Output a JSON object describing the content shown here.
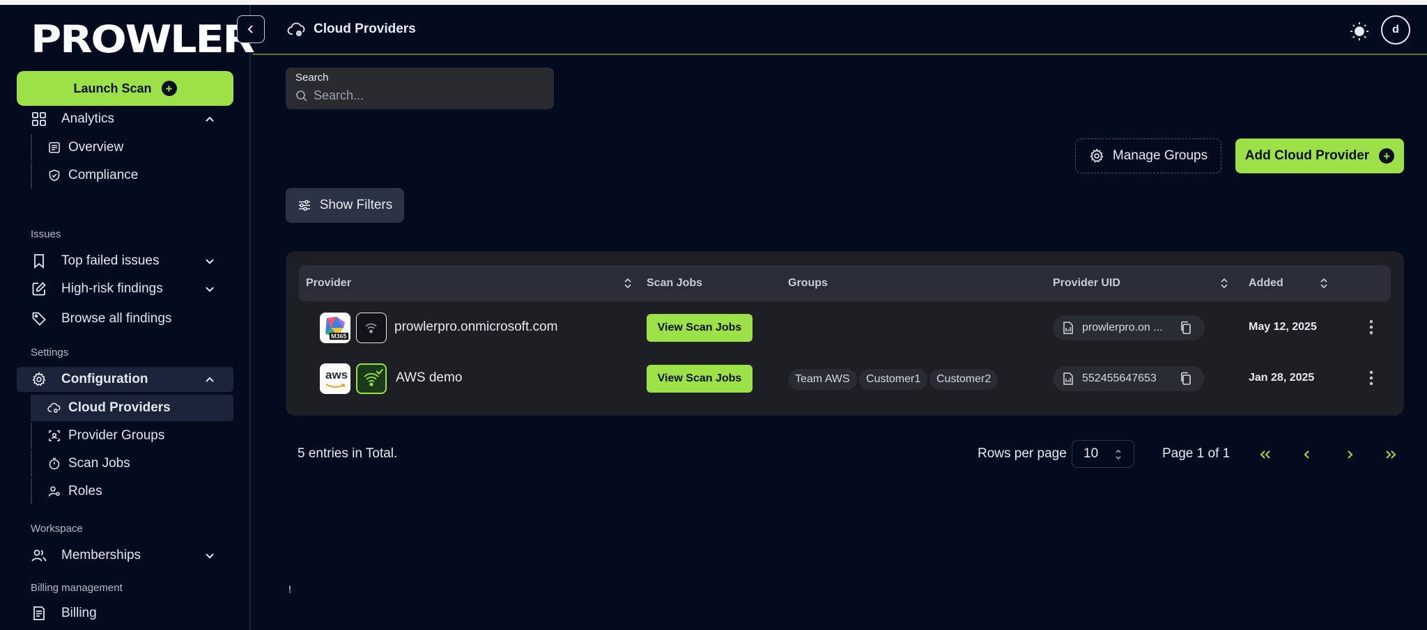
{
  "app": {
    "logo_text": "PROWLER"
  },
  "sidebar": {
    "launch_scan": "Launch Scan",
    "analytics": "Analytics",
    "overview": "Overview",
    "compliance": "Compliance",
    "issues_section": "Issues",
    "top_failed": "Top failed issues",
    "high_risk": "High-risk findings",
    "browse_all": "Browse all findings",
    "settings_section": "Settings",
    "configuration": "Configuration",
    "cloud_providers": "Cloud Providers",
    "provider_groups": "Provider Groups",
    "scan_jobs": "Scan Jobs",
    "roles": "Roles",
    "workspace_section": "Workspace",
    "memberships": "Memberships",
    "billing_section": "Billing management",
    "billing": "Billing"
  },
  "header": {
    "title": "Cloud Providers",
    "avatar_initial": "d"
  },
  "search": {
    "label": "Search",
    "placeholder": "Search..."
  },
  "actions": {
    "manage_groups": "Manage Groups",
    "add_provider": "Add Cloud Provider",
    "show_filters": "Show Filters"
  },
  "table": {
    "columns": {
      "provider": "Provider",
      "scan_jobs": "Scan Jobs",
      "groups": "Groups",
      "provider_uid": "Provider UID",
      "added": "Added"
    },
    "rows": [
      {
        "logo_label": "M365",
        "name": "prowlerpro.onmicrosoft.com",
        "scan_button": "View Scan Jobs",
        "groups": [],
        "uid": "prowlerpro.on ...",
        "added": "May 12, 2025",
        "status_color": "#6b6f7a"
      },
      {
        "logo_label": "aws",
        "name": "AWS demo",
        "scan_button": "View Scan Jobs",
        "groups": [
          "Team AWS",
          "Customer1",
          "Customer2"
        ],
        "uid": "552455647653",
        "added": "Jan 28, 2025",
        "status_color": "#9be147"
      }
    ]
  },
  "pagination": {
    "total": "5 entries in Total.",
    "rows_per_page_label": "Rows per page",
    "rows_per_page_value": "10",
    "page_label": "Page 1 of 1"
  },
  "stray_mark": "!",
  "colors": {
    "accent": "#9be147",
    "background": "#050b1f",
    "card": "#1e1f24"
  }
}
